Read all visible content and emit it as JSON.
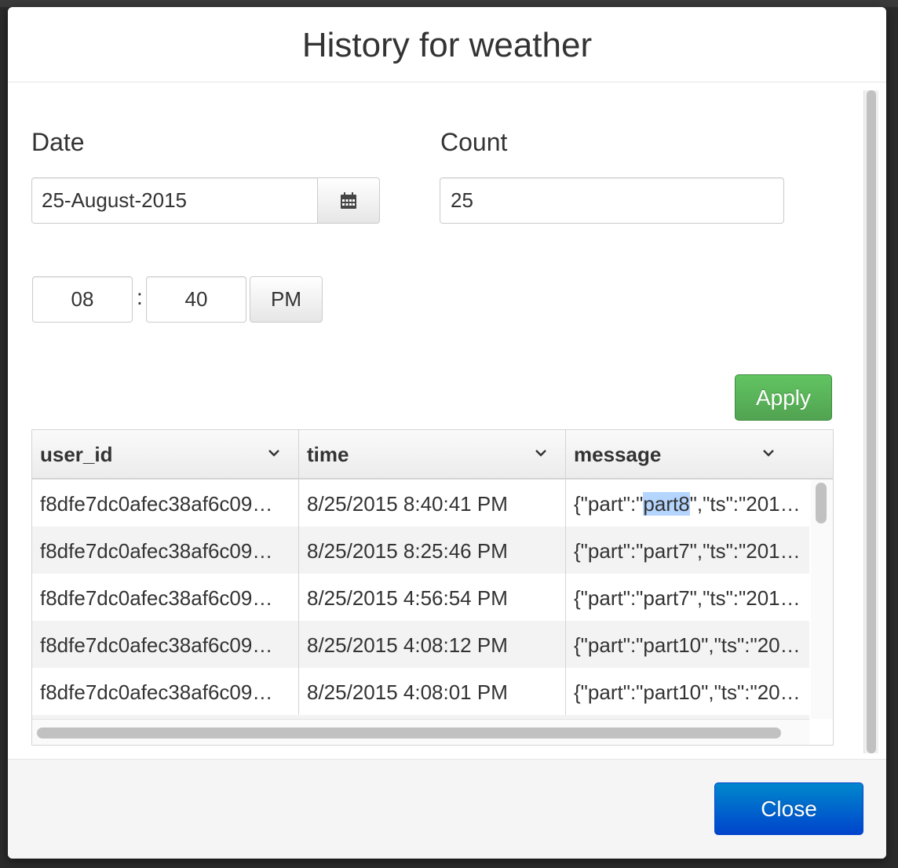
{
  "modal": {
    "title": "History for weather"
  },
  "form": {
    "date_label": "Date",
    "date_value": "25-August-2015",
    "count_label": "Count",
    "count_value": "25",
    "hour_value": "08",
    "time_separator": ":",
    "minute_value": "40",
    "ampm_label": "PM",
    "apply_label": "Apply"
  },
  "table": {
    "columns": [
      "user_id",
      "time",
      "message"
    ],
    "rows": [
      {
        "user_id": "f8dfe7dc0afec38af6c09…",
        "time": "8/25/2015 8:40:41 PM",
        "msg_pre": "{\"part\":\"",
        "msg_sel": "part8",
        "msg_post": "\",\"ts\":\"201…"
      },
      {
        "user_id": "f8dfe7dc0afec38af6c09…",
        "time": "8/25/2015 8:25:46 PM",
        "message": "{\"part\":\"part7\",\"ts\":\"201…"
      },
      {
        "user_id": "f8dfe7dc0afec38af6c09…",
        "time": "8/25/2015 4:56:54 PM",
        "message": "{\"part\":\"part7\",\"ts\":\"201…"
      },
      {
        "user_id": "f8dfe7dc0afec38af6c09…",
        "time": "8/25/2015 4:08:12 PM",
        "message": "{\"part\":\"part10\",\"ts\":\"20…"
      },
      {
        "user_id": "f8dfe7dc0afec38af6c09…",
        "time": "8/25/2015 4:08:01 PM",
        "message": "{\"part\":\"part10\",\"ts\":\"20…"
      }
    ]
  },
  "footer": {
    "close_label": "Close"
  },
  "colors": {
    "apply_green": "#5bb75b",
    "close_blue": "#0066cc",
    "selection": "#b4d5fe"
  },
  "icons": [
    "calendar-icon",
    "chevron-down-icon"
  ]
}
